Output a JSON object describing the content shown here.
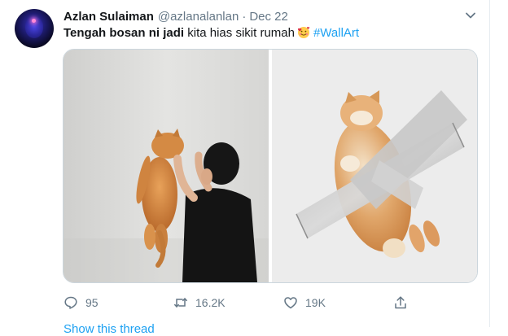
{
  "tweet": {
    "author_name": "Azlan Sulaiman",
    "handle": "@azlanalanlan",
    "separator": "·",
    "date": "Dec 22",
    "text_bold": "Tengah bosan ni jadi",
    "text_rest": "kita hias sikit rumah",
    "emoji_icon": "smiling-face-with-hearts-emoji",
    "hashtag": "#WallArt"
  },
  "media": {
    "photo_left": "photo",
    "photo_right": "photo"
  },
  "actions": {
    "reply_count": "95",
    "retweet_count": "16.2K",
    "like_count": "19K",
    "share_icon": "share-icon"
  },
  "footer": {
    "show_thread": "Show this thread"
  },
  "colors": {
    "accent": "#1da1f2",
    "muted": "#657786",
    "text": "#14171a",
    "border": "#ccd6dd"
  }
}
